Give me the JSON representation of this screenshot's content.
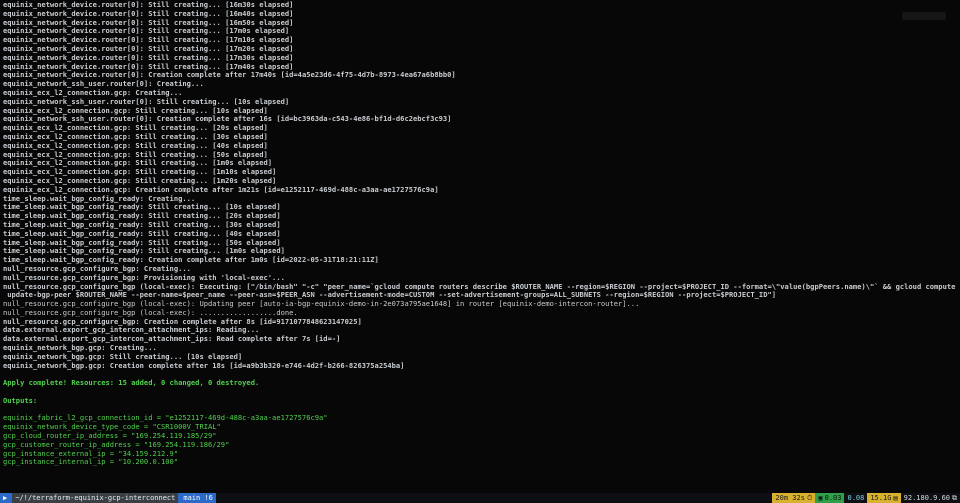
{
  "terminal_lines": [
    {
      "text": "equinix_network_device.router[0]: Still creating... [16m30s elapsed]",
      "style": "b"
    },
    {
      "text": "equinix_network_device.router[0]: Still creating... [16m40s elapsed]",
      "style": "b"
    },
    {
      "text": "equinix_network_device.router[0]: Still creating... [16m50s elapsed]",
      "style": "b"
    },
    {
      "text": "equinix_network_device.router[0]: Still creating... [17m0s elapsed]",
      "style": "b"
    },
    {
      "text": "equinix_network_device.router[0]: Still creating... [17m10s elapsed]",
      "style": "b"
    },
    {
      "text": "equinix_network_device.router[0]: Still creating... [17m20s elapsed]",
      "style": "b"
    },
    {
      "text": "equinix_network_device.router[0]: Still creating... [17m30s elapsed]",
      "style": "b"
    },
    {
      "text": "equinix_network_device.router[0]: Still creating... [17m40s elapsed]",
      "style": "b"
    },
    {
      "text": "equinix_network_device.router[0]: Creation complete after 17m40s [id=4a5e23d6-4f75-4d7b-8973-4ea67a6b8bb0]",
      "style": "b"
    },
    {
      "text": "equinix_network_ssh_user.router[0]: Creating...",
      "style": "b"
    },
    {
      "text": "equinix_ecx_l2_connection.gcp: Creating...",
      "style": "b"
    },
    {
      "text": "equinix_network_ssh_user.router[0]: Still creating... [10s elapsed]",
      "style": "b"
    },
    {
      "text": "equinix_ecx_l2_connection.gcp: Still creating... [10s elapsed]",
      "style": "b"
    },
    {
      "text": "equinix_network_ssh_user.router[0]: Creation complete after 16s [id=bc3963da-c543-4e86-bf1d-d6c2ebcf3c93]",
      "style": "b"
    },
    {
      "text": "equinix_ecx_l2_connection.gcp: Still creating... [20s elapsed]",
      "style": "b"
    },
    {
      "text": "equinix_ecx_l2_connection.gcp: Still creating... [30s elapsed]",
      "style": "b"
    },
    {
      "text": "equinix_ecx_l2_connection.gcp: Still creating... [40s elapsed]",
      "style": "b"
    },
    {
      "text": "equinix_ecx_l2_connection.gcp: Still creating... [50s elapsed]",
      "style": "b"
    },
    {
      "text": "equinix_ecx_l2_connection.gcp: Still creating... [1m0s elapsed]",
      "style": "b"
    },
    {
      "text": "equinix_ecx_l2_connection.gcp: Still creating... [1m10s elapsed]",
      "style": "b"
    },
    {
      "text": "equinix_ecx_l2_connection.gcp: Still creating... [1m20s elapsed]",
      "style": "b"
    },
    {
      "text": "equinix_ecx_l2_connection.gcp: Creation complete after 1m21s [id=e1252117-469d-488c-a3aa-ae1727576c9a]",
      "style": "b"
    },
    {
      "text": "time_sleep.wait_bgp_config_ready: Creating...",
      "style": "b"
    },
    {
      "text": "time_sleep.wait_bgp_config_ready: Still creating... [10s elapsed]",
      "style": "b"
    },
    {
      "text": "time_sleep.wait_bgp_config_ready: Still creating... [20s elapsed]",
      "style": "b"
    },
    {
      "text": "time_sleep.wait_bgp_config_ready: Still creating... [30s elapsed]",
      "style": "b"
    },
    {
      "text": "time_sleep.wait_bgp_config_ready: Still creating... [40s elapsed]",
      "style": "b"
    },
    {
      "text": "time_sleep.wait_bgp_config_ready: Still creating... [50s elapsed]",
      "style": "b"
    },
    {
      "text": "time_sleep.wait_bgp_config_ready: Still creating... [1m0s elapsed]",
      "style": "b"
    },
    {
      "text": "time_sleep.wait_bgp_config_ready: Creation complete after 1m0s [id=2022-05-31T18:21:11Z]",
      "style": "b"
    },
    {
      "text": "null_resource.gcp_configure_bgp: Creating...",
      "style": "b"
    },
    {
      "text": "null_resource.gcp_configure_bgp: Provisioning with 'local-exec'...",
      "style": "b"
    },
    {
      "text": "null_resource.gcp_configure_bgp (local-exec): Executing: [\"/bin/bash\" \"-c\" \"peer_name=`gcloud compute routers describe $ROUTER_NAME --region=$REGION --project=$PROJECT_ID --format=\\\"value(bgpPeers.name)\\\"` && gcloud compute routers",
      "style": "b"
    },
    {
      "text": " update-bgp-peer $ROUTER_NAME --peer-name=$peer_name --peer-asn=$PEER_ASN --advertisement-mode=CUSTOM --set-advertisement-groups=ALL_SUBNETS --region=$REGION --project=$PROJECT_ID\"]",
      "style": "b"
    },
    {
      "text": "null_resource.gcp_configure_bgp (local-exec): Updating peer [auto-ia-bgp-equinix-demo-in-2e073a795ae1648] in router [equinix-demo-intercon-router]...",
      "style": ""
    },
    {
      "text": "null_resource.gcp_configure_bgp (local-exec): ..................done.",
      "style": ""
    },
    {
      "text": "null_resource.gcp_configure_bgp: Creation complete after 8s [id=9171077848623147025]",
      "style": "b"
    },
    {
      "text": "data.external.export_gcp_intercon_attachment_ips: Reading...",
      "style": "b"
    },
    {
      "text": "data.external.export_gcp_intercon_attachment_ips: Read complete after 7s [id=-]",
      "style": "b"
    },
    {
      "text": "equinix_network_bgp.gcp: Creating...",
      "style": "b"
    },
    {
      "text": "equinix_network_bgp.gcp: Still creating... [10s elapsed]",
      "style": "b"
    },
    {
      "text": "equinix_network_bgp.gcp: Creation complete after 18s [id=a9b3b320-e746-4d2f-b266-826375a254ba]",
      "style": "b"
    },
    {
      "text": "",
      "style": ""
    },
    {
      "text": "Apply complete! Resources: 15 added, 0 changed, 0 destroyed.",
      "style": "g b"
    },
    {
      "text": "",
      "style": ""
    },
    {
      "text": "Outputs:",
      "style": "g b"
    },
    {
      "text": "",
      "style": ""
    },
    {
      "text": "equinix_fabric_l2_gcp_connection_id = \"e1252117-469d-488c-a3aa-ae1727576c9a\"",
      "style": "g"
    },
    {
      "text": "equinix_network_device_type_code = \"CSR1000V_TRIAL\"",
      "style": "g"
    },
    {
      "text": "gcp_cloud_router_ip_address = \"169.254.119.185/29\"",
      "style": "g"
    },
    {
      "text": "gcp_customer_router_ip_address = \"169.254.119.186/29\"",
      "style": "g"
    },
    {
      "text": "gcp_instance_external_ip = \"34.159.212.9\"",
      "style": "g"
    },
    {
      "text": "gcp_instance_internal_ip = \"10.200.0.100\"",
      "style": "g"
    }
  ],
  "statusbar": {
    "left_icon": "▶",
    "path": "~/!/terraform-equinix-gcp-interconnect",
    "branch_icon": "",
    "branch": "main !6",
    "time_icon": "⏱",
    "time": "20m 32s",
    "cpu_icon": "▣",
    "cpu": "0.03",
    "load": "0.08",
    "mem": "15.1G",
    "mem_icon": "▤",
    "ip": "92.180.9.60",
    "ip_icon": "⧉"
  }
}
